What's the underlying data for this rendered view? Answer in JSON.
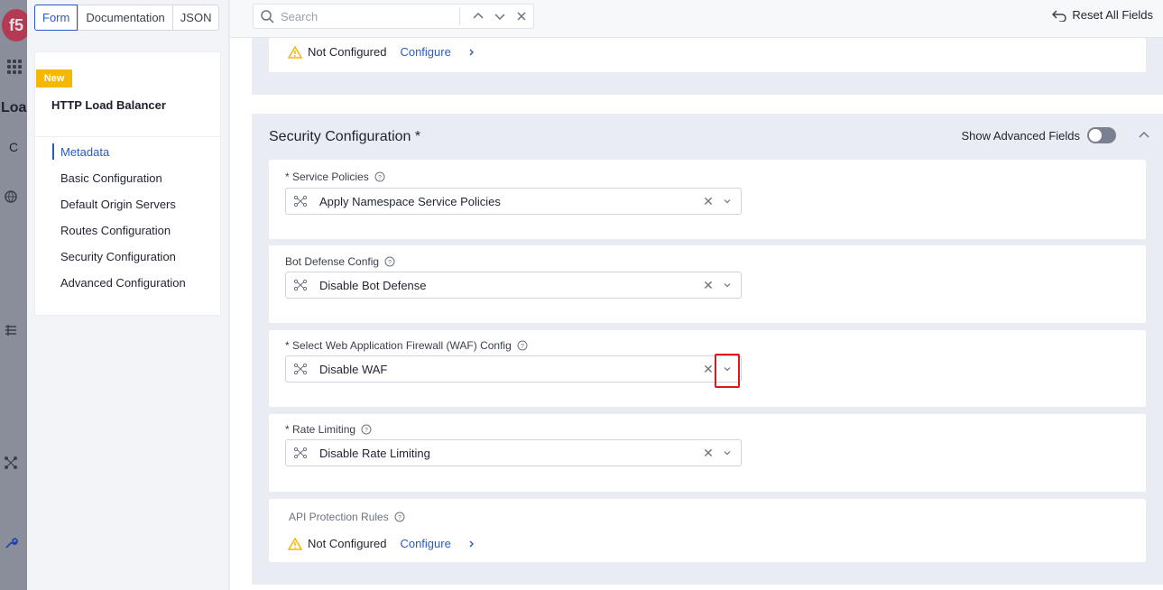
{
  "bg": {
    "logo_text": "f5",
    "title_fragment": "Loa",
    "sub_fragment": "C"
  },
  "mode_tabs": [
    "Form",
    "Documentation",
    "JSON"
  ],
  "nav": {
    "badge": "New",
    "title": "HTTP Load Balancer",
    "items": [
      {
        "label": "Metadata",
        "active": true
      },
      {
        "label": "Basic Configuration"
      },
      {
        "label": "Default Origin Servers"
      },
      {
        "label": "Routes Configuration"
      },
      {
        "label": "Security Configuration"
      },
      {
        "label": "Advanced Configuration"
      }
    ]
  },
  "toolbar": {
    "search_placeholder": "Search",
    "reset_label": "Reset All Fields"
  },
  "top_section": {
    "status": "Not Configured",
    "configure": "Configure"
  },
  "security": {
    "title": "Security Configuration",
    "required_marker": "*",
    "show_advanced_label": "Show Advanced Fields",
    "fields": {
      "service_policies": {
        "label": "* Service Policies",
        "value": "Apply Namespace Service Policies"
      },
      "bot_defense": {
        "label": "Bot Defense Config",
        "value": "Disable Bot Defense"
      },
      "waf": {
        "label": "* Select Web Application Firewall (WAF) Config",
        "value": "Disable WAF"
      },
      "rate_limiting": {
        "label": "* Rate Limiting",
        "value": "Disable Rate Limiting"
      },
      "api_protection": {
        "label": "API Protection Rules",
        "status": "Not Configured",
        "configure": "Configure"
      }
    }
  },
  "colors": {
    "accent": "#2b59c3",
    "warning": "#f5b800",
    "highlight": "#e0161b"
  }
}
